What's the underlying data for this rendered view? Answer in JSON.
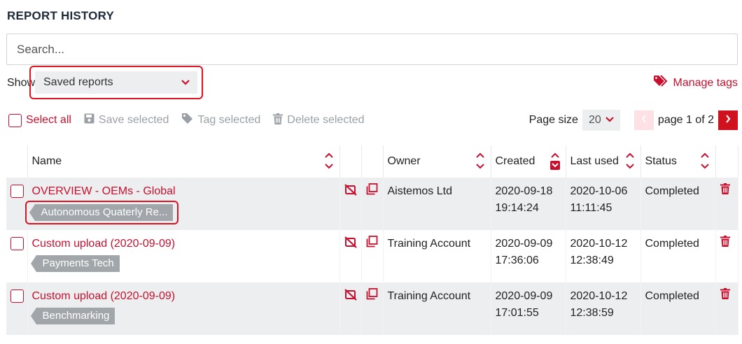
{
  "page": {
    "title": "REPORT HISTORY"
  },
  "search": {
    "placeholder": "Search..."
  },
  "filter": {
    "show_label": "Show",
    "selected": "Saved reports"
  },
  "manage_tags": {
    "label": "Manage tags"
  },
  "toolbar": {
    "select_all": "Select all",
    "save_selected": "Save selected",
    "tag_selected": "Tag selected",
    "delete_selected": "Delete selected"
  },
  "pager": {
    "page_size_label": "Page size",
    "page_size": "20",
    "page_text": "page 1 of 2"
  },
  "table": {
    "headers": {
      "name": "Name",
      "owner": "Owner",
      "created": "Created",
      "last_used": "Last used",
      "status": "Status"
    },
    "rows": [
      {
        "name": "OVERVIEW - OEMs - Global",
        "tag": "Autonomous Quaterly Re...",
        "owner": "Aistemos Ltd",
        "created_date": "2020-09-18",
        "created_time": "19:14:24",
        "last_date": "2020-10-06",
        "last_time": "11:11:45",
        "status": "Completed"
      },
      {
        "name": "Custom upload (2020-09-09)",
        "tag": "Payments Tech",
        "owner": "Training Account",
        "created_date": "2020-09-09",
        "created_time": "17:36:06",
        "last_date": "2020-10-12",
        "last_time": "12:38:49",
        "status": "Completed"
      },
      {
        "name": "Custom upload (2020-09-09)",
        "tag": "Benchmarking",
        "owner": "Training Account",
        "created_date": "2020-09-09",
        "created_time": "17:01:55",
        "last_date": "2020-10-12",
        "last_time": "12:38:59",
        "status": "Completed"
      }
    ]
  },
  "colors": {
    "accent": "#c8102e",
    "highlight": "#e0121f",
    "row_alt": "#eceeef",
    "tag_bg": "#a1a6ab"
  },
  "icons": [
    "tag-icon",
    "save-icon",
    "trash-icon",
    "chevron-down-icon",
    "chevron-left-icon",
    "chevron-right-icon",
    "sort-icon",
    "unshare-icon",
    "duplicate-icon"
  ]
}
